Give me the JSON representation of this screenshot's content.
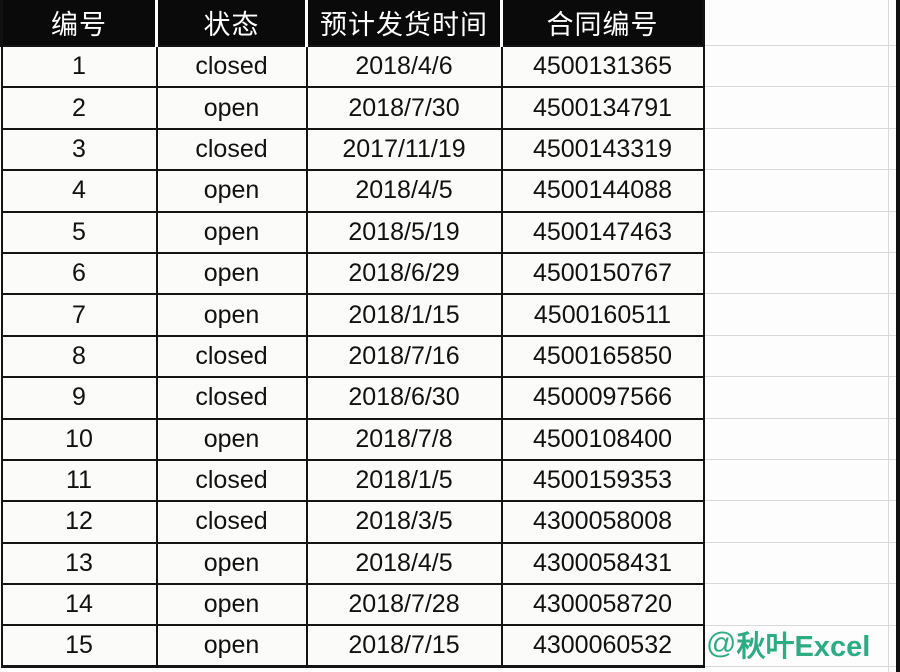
{
  "table": {
    "columns": [
      "编号",
      "状态",
      "预计发货时间",
      "合同编号"
    ],
    "rows": [
      {
        "id": "1",
        "status": "closed",
        "date": "2018/4/6",
        "contract": "4500131365"
      },
      {
        "id": "2",
        "status": "open",
        "date": "2018/7/30",
        "contract": "4500134791"
      },
      {
        "id": "3",
        "status": "closed",
        "date": "2017/11/19",
        "contract": "4500143319"
      },
      {
        "id": "4",
        "status": "open",
        "date": "2018/4/5",
        "contract": "4500144088"
      },
      {
        "id": "5",
        "status": "open",
        "date": "2018/5/19",
        "contract": "4500147463"
      },
      {
        "id": "6",
        "status": "open",
        "date": "2018/6/29",
        "contract": "4500150767"
      },
      {
        "id": "7",
        "status": "open",
        "date": "2018/1/15",
        "contract": "4500160511"
      },
      {
        "id": "8",
        "status": "closed",
        "date": "2018/7/16",
        "contract": "4500165850"
      },
      {
        "id": "9",
        "status": "closed",
        "date": "2018/6/30",
        "contract": "4500097566"
      },
      {
        "id": "10",
        "status": "open",
        "date": "2018/7/8",
        "contract": "4500108400"
      },
      {
        "id": "11",
        "status": "closed",
        "date": "2018/1/5",
        "contract": "4500159353"
      },
      {
        "id": "12",
        "status": "closed",
        "date": "2018/3/5",
        "contract": "4300058008"
      },
      {
        "id": "13",
        "status": "open",
        "date": "2018/4/5",
        "contract": "4300058431"
      },
      {
        "id": "14",
        "status": "open",
        "date": "2018/7/28",
        "contract": "4300058720"
      },
      {
        "id": "15",
        "status": "open",
        "date": "2018/7/15",
        "contract": "4300060532"
      }
    ]
  },
  "watermark": {
    "at_symbol": "@",
    "text": "秋叶Excel",
    "color": "#2fab83"
  },
  "colors": {
    "header_background": "#0a0a0a",
    "header_text": "#ffffff",
    "cell_background": "#fbfbfa",
    "cell_text": "#111111",
    "grid_line": "#141414",
    "ghost_grid_line": "#d8d8d8"
  }
}
